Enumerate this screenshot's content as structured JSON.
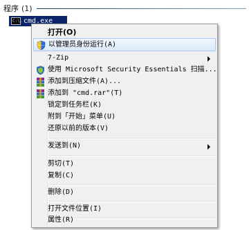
{
  "section": {
    "title": "程序",
    "count": "(1)"
  },
  "result": {
    "label": "cmd.exe",
    "icon_text": "C:\\."
  },
  "menu": {
    "items": [
      {
        "label": "打开(O)",
        "icon": "none"
      },
      {
        "label": "以管理员身份运行(A)",
        "icon": "shield-icon"
      },
      {
        "label": "7-Zip",
        "icon": "none"
      },
      {
        "label": "使用 Microsoft Security Essentials 扫描...",
        "icon": "mse-icon"
      },
      {
        "label": "添加到压缩文件(A)...",
        "icon": "winrar-icon"
      },
      {
        "label": "添加到 \"cmd.rar\"(T)",
        "icon": "winrar-icon"
      },
      {
        "label": "锁定到任务栏(K)",
        "icon": "none"
      },
      {
        "label": "附到「开始」菜单(U)",
        "icon": "none"
      },
      {
        "label": "还原以前的版本(V)",
        "icon": "none"
      },
      {
        "label": "发送到(N)",
        "icon": "none"
      },
      {
        "label": "剪切(T)",
        "icon": "none"
      },
      {
        "label": "复制(C)",
        "icon": "none"
      },
      {
        "label": "删除(D)",
        "icon": "none"
      },
      {
        "label": "打开文件位置(I)",
        "icon": "none"
      },
      {
        "label": "属性(R)",
        "icon": "none"
      }
    ]
  },
  "colors": {
    "selection_bg": "#0a246a",
    "menu_bg": "#f0f0f0",
    "highlight_border": "#a8c8ef"
  }
}
